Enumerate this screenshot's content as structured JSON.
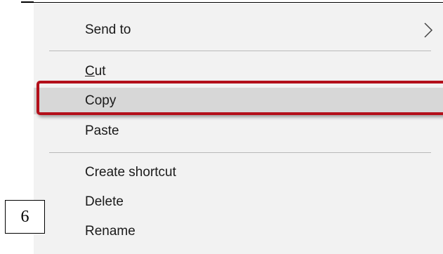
{
  "context_menu": {
    "items": [
      {
        "label": "Send to",
        "has_submenu": true
      },
      {
        "label_accel": "C",
        "label_rest": "ut"
      },
      {
        "label": "Copy",
        "highlighted": true
      },
      {
        "label": "Paste"
      },
      {
        "label": "Create shortcut"
      },
      {
        "label": "Delete"
      },
      {
        "label": "Rename"
      }
    ],
    "submenu_icon": "chevron-right-icon",
    "colors": {
      "menu_background": "#f2f2f2",
      "hover_background": "#d7d7d7",
      "highlight_border": "#b30f1a",
      "separator": "#b9b9b9"
    }
  },
  "annotation": {
    "step_number": "6"
  }
}
